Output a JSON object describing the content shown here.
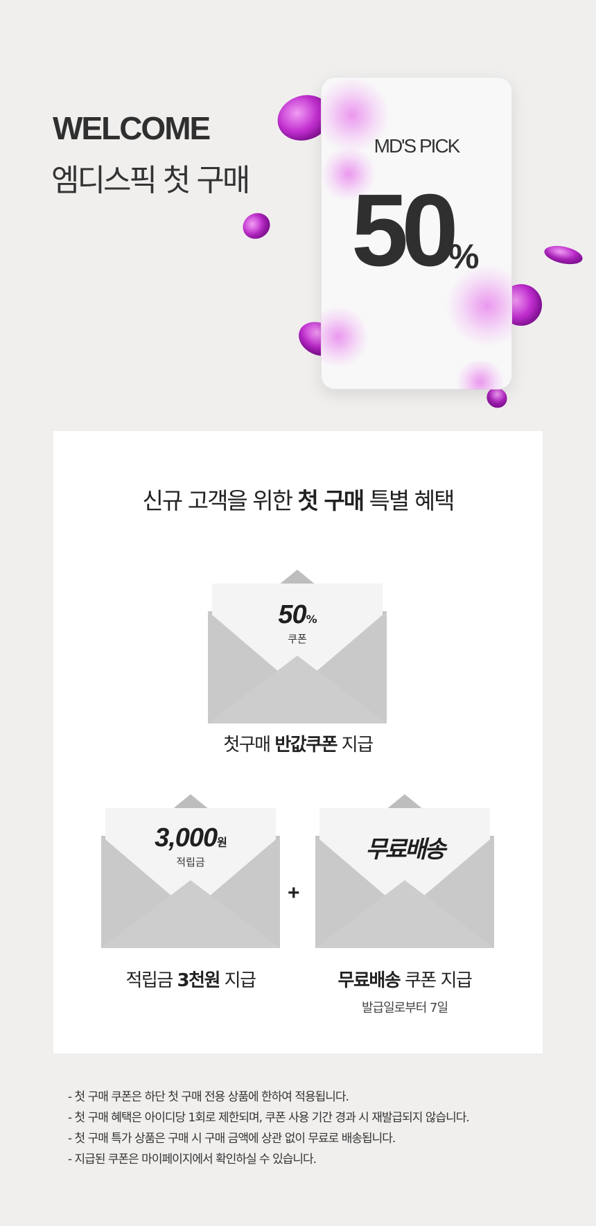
{
  "hero": {
    "title_en": "WELCOME",
    "title_ko": "엠디스픽 첫 구매",
    "card": {
      "brand": "MD'S PICK",
      "number": "50",
      "unit": "%"
    }
  },
  "panel": {
    "heading": {
      "part1": "신규 고객을 위한 ",
      "bold": "첫 구매",
      "part2": " 특별 혜택"
    },
    "coupon_half": {
      "big": "50",
      "unit": "%",
      "small": "쿠폰",
      "caption_pre": "첫구매 ",
      "caption_bold": "반값쿠폰",
      "caption_post": " 지급"
    },
    "coupon_points": {
      "big": "3,000",
      "unit": "원",
      "small": "적립금",
      "caption_pre": "적립금 ",
      "caption_bold": "3천원",
      "caption_post": " 지급"
    },
    "plus": "+",
    "coupon_shipping": {
      "big": "무료배송",
      "caption_bold": "무료배송",
      "caption_post": " 쿠폰 지급",
      "sub": "발급일로부터 7일"
    }
  },
  "notes": [
    "- 첫 구매 쿠폰은 하단 첫 구매 전용 상품에 한하여 적용됩니다.",
    "- 첫 구매 혜택은 아이디당 1회로 제한되며, 쿠폰 사용 기간 경과 시 재발급되지 않습니다.",
    "- 첫 구매 특가 상품은 구매 시 구매 금액에 상관 없이 무료로 배송됩니다.",
    "- 지급된 쿠폰은 마이페이지에서 확인하실 수 있습니다."
  ],
  "colors": {
    "background": "#f0efee",
    "coin_purple": "#c22fd0",
    "envelope_gray": "#c4c4c4"
  }
}
